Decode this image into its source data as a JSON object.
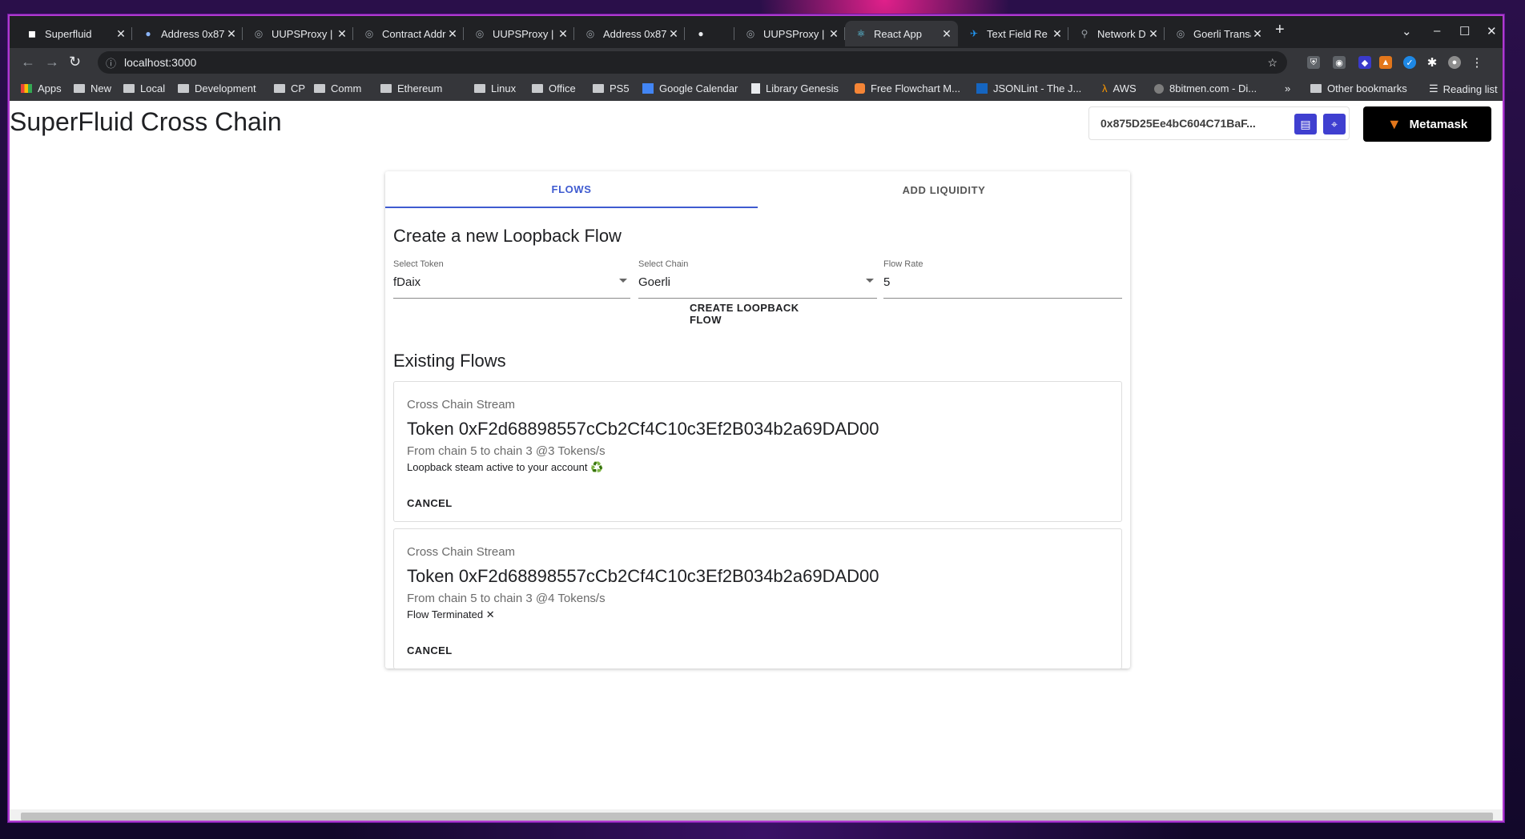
{
  "tabs": [
    {
      "label": "Superfluid",
      "fav": "◼",
      "favColor": "#ffffff"
    },
    {
      "label": "Address 0x87",
      "fav": "●",
      "favColor": "#8ab4f8"
    },
    {
      "label": "UUPSProxy | C",
      "fav": "◎",
      "favColor": "#9aa0a6"
    },
    {
      "label": "Contract Addr",
      "fav": "◎",
      "favColor": "#9aa0a6"
    },
    {
      "label": "UUPSProxy | C",
      "fav": "◎",
      "favColor": "#9aa0a6"
    },
    {
      "label": "Address 0x87",
      "fav": "◎",
      "favColor": "#9aa0a6"
    },
    {
      "label": "UUPSProxy | C",
      "fav": "◎",
      "favColor": "#9aa0a6"
    },
    {
      "label": "React App",
      "fav": "⚛",
      "favColor": "#61dafb"
    },
    {
      "label": "Text Field Re",
      "fav": "✈",
      "favColor": "#2196f3"
    },
    {
      "label": "Network D",
      "fav": "🔗",
      "favColor": "#9aa0a6"
    },
    {
      "label": "Goerli Transa",
      "fav": "◎",
      "favColor": "#9aa0a6"
    }
  ],
  "url": "localhost:3000",
  "bookmarks": [
    "Apps",
    "New",
    "Local",
    "Development",
    "CP",
    "Comm",
    "Ethereum",
    "Linux",
    "Office",
    "PS5",
    "Google Calendar",
    "Library Genesis",
    "Free Flowchart M...",
    "JSONLint - The J...",
    "AWS",
    "8bitmen.com - Di..."
  ],
  "bookmarks_right": {
    "overflow": "»",
    "other": "Other bookmarks",
    "reading": "Reading list"
  },
  "app": {
    "title": "SuperFluid Cross Chain",
    "address": "0x875D25Ee4bC604C71BaF...",
    "wallet_button": "Metamask"
  },
  "main_tabs": {
    "flows": "FLOWS",
    "liquidity": "ADD LIQUIDITY"
  },
  "create": {
    "heading": "Create a new Loopback Flow",
    "token_label": "Select Token",
    "token_value": "fDaix",
    "chain_label": "Select Chain",
    "chain_value": "Goerli",
    "rate_label": "Flow Rate",
    "rate_value": "5",
    "button": "CREATE LOOPBACK FLOW"
  },
  "existing": {
    "heading": "Existing Flows",
    "flows": [
      {
        "kind": "Cross Chain Stream",
        "token": "Token 0xF2d68898557cCb2Cf4C10c3Ef2B034b2a69DAD00",
        "route": "From chain 5 to chain 3 @3 Tokens/s",
        "status": "Loopback steam active to your account ♻️",
        "cancel": "CANCEL"
      },
      {
        "kind": "Cross Chain Stream",
        "token": "Token 0xF2d68898557cCb2Cf4C10c3Ef2B034b2a69DAD00",
        "route": "From chain 5 to chain 3 @4 Tokens/s",
        "status": "Flow Terminated ✕",
        "cancel": "CANCEL"
      }
    ]
  }
}
